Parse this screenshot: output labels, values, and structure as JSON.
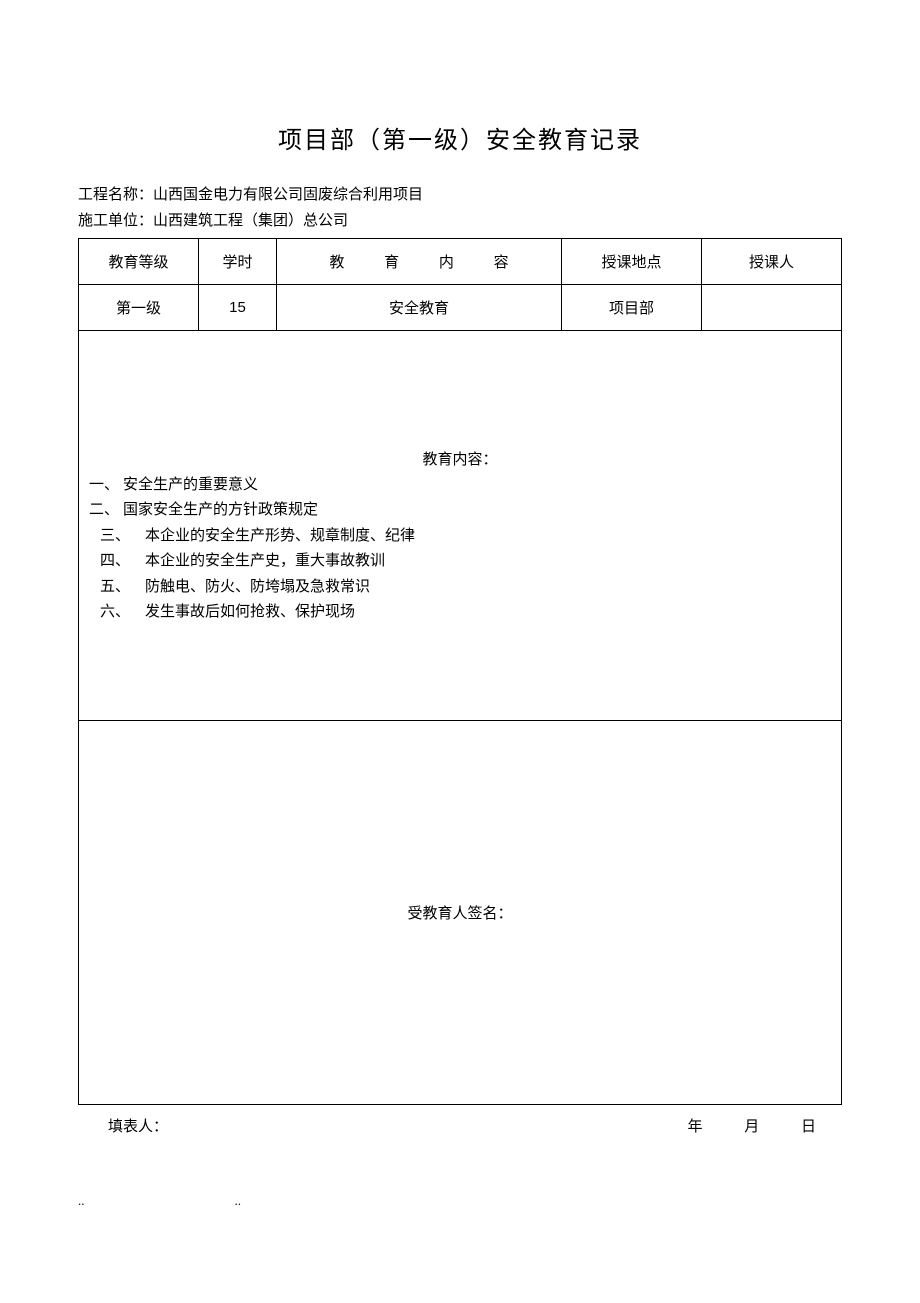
{
  "title": "项目部（第一级）安全教育记录",
  "meta": {
    "project_label": "工程名称：",
    "project_value": "山西国金电力有限公司固废综合利用项目",
    "unit_label": "施工单位：",
    "unit_value": "山西建筑工程（集团）总公司"
  },
  "table": {
    "headers": {
      "level": "教育等级",
      "hours": "学时",
      "content": "教 育 内 容",
      "location": "授课地点",
      "lecturer": "授课人"
    },
    "row": {
      "level": "第一级",
      "hours": "15",
      "content": "安全教育",
      "location": "项目部",
      "lecturer": ""
    }
  },
  "content": {
    "heading": "教育内容：",
    "items": [
      {
        "num": "一、",
        "style": "a",
        "text": "安全生产的重要意义"
      },
      {
        "num": "二、",
        "style": "a",
        "text": "国家安全生产的方针政策规定"
      },
      {
        "num": "三、",
        "style": "b",
        "text": "本企业的安全生产形势、规章制度、纪律"
      },
      {
        "num": "四、",
        "style": "b",
        "text": "本企业的安全生产史，重大事故教训"
      },
      {
        "num": "五、",
        "style": "b",
        "text": "防触电、防火、防垮塌及急救常识"
      },
      {
        "num": "六、",
        "style": "b",
        "text": "发生事故后如何抢救、保护现场"
      }
    ]
  },
  "signature": {
    "label": "受教育人签名："
  },
  "footer": {
    "filler_label": "填表人：",
    "year": "年",
    "month": "月",
    "day": "日"
  },
  "dots": ".."
}
